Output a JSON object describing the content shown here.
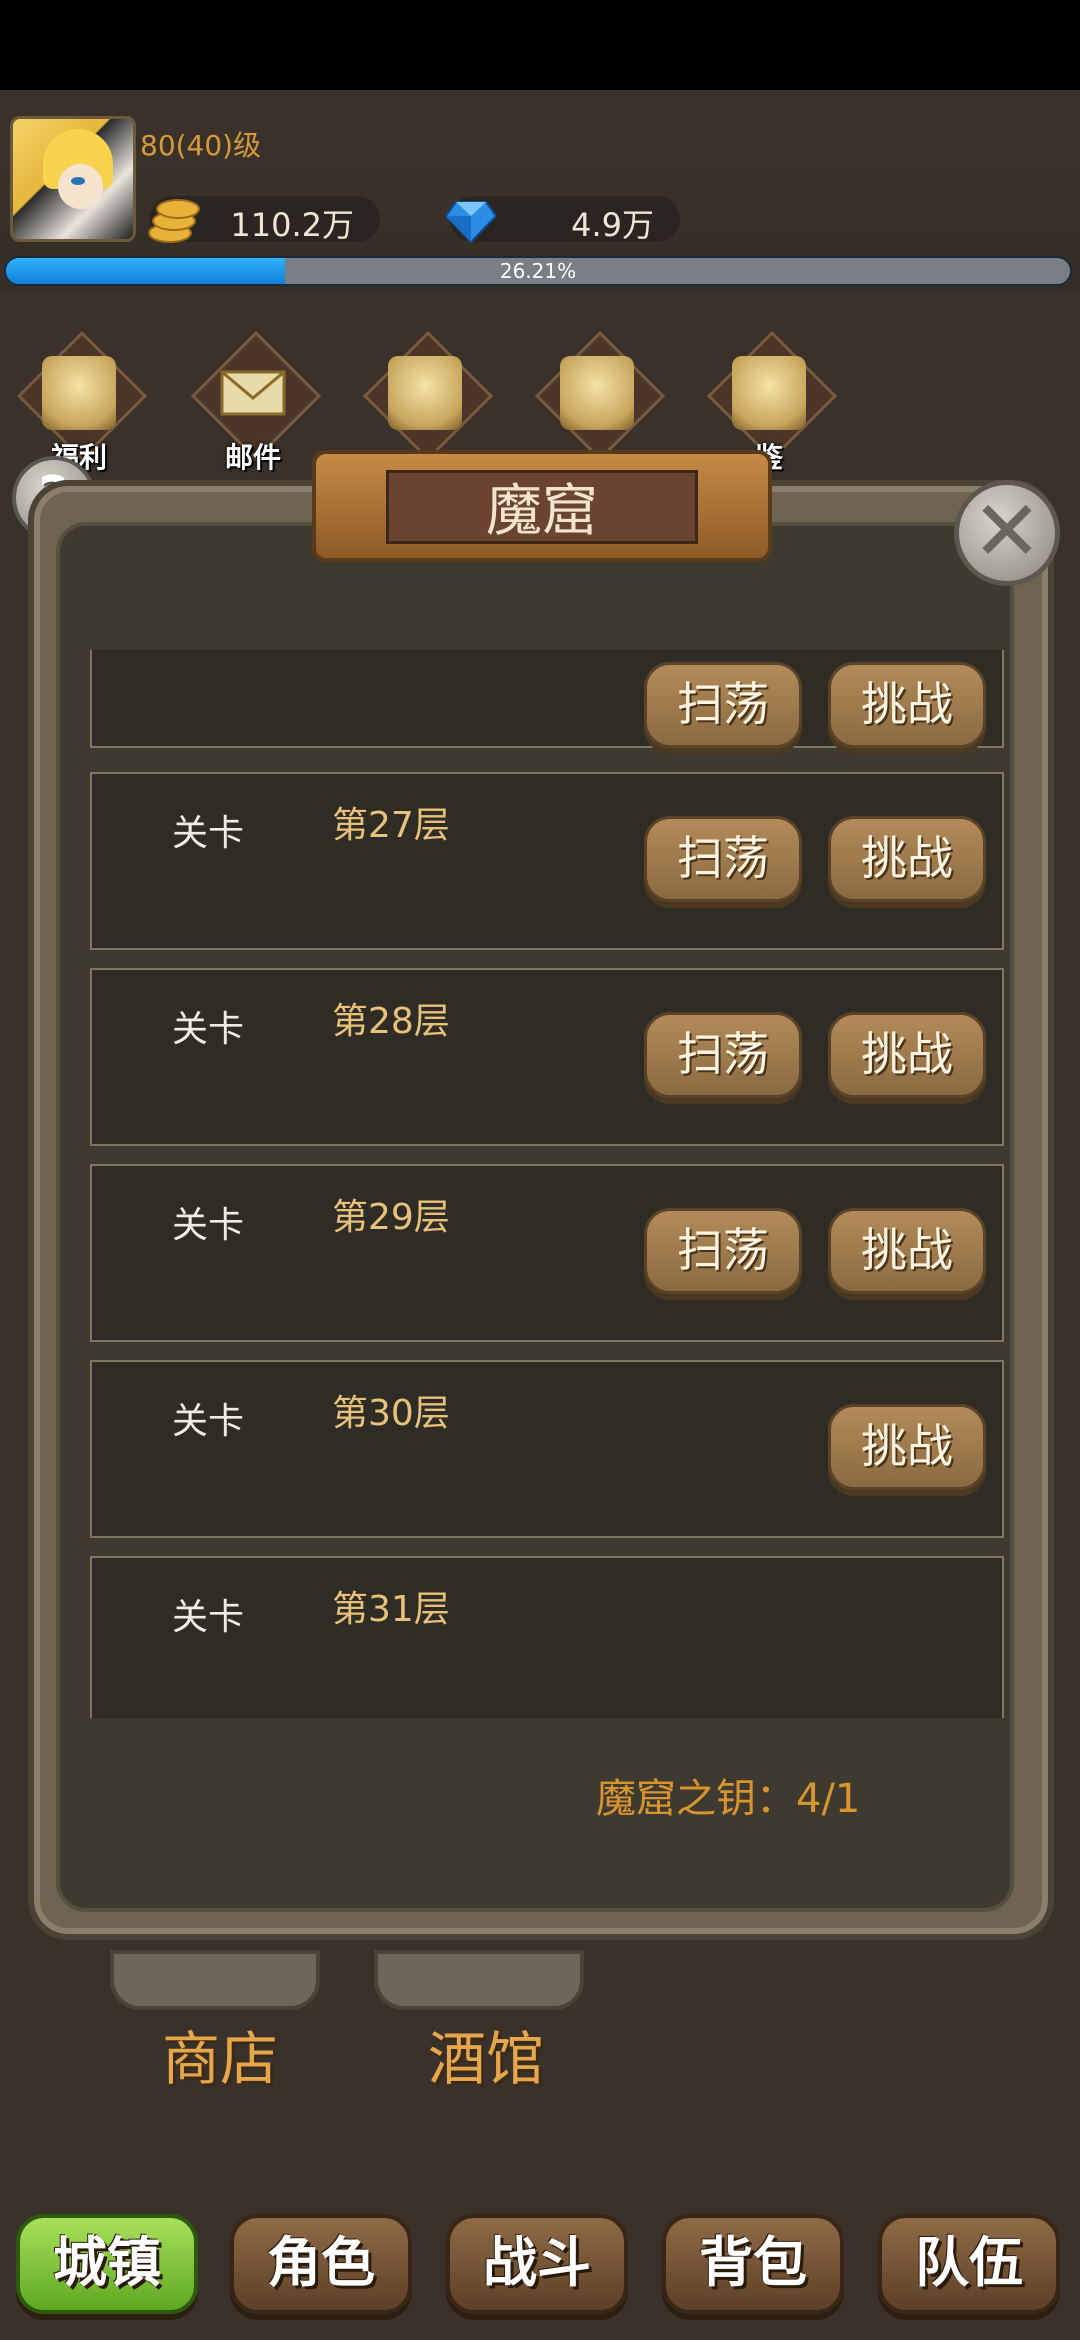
{
  "player": {
    "level": "80(40)级",
    "gold": "110.2万",
    "gems": "4.9万",
    "exp_percent": 26.21,
    "exp_label": "26.21%"
  },
  "top_icons": [
    {
      "name": "welfare",
      "label": "福利"
    },
    {
      "name": "mail",
      "label": "邮件"
    },
    {
      "name": "unknown1",
      "label": ""
    },
    {
      "name": "treasure",
      "label": ""
    },
    {
      "name": "codex",
      "label": "鉴"
    }
  ],
  "dialog": {
    "title": "魔窟",
    "rows": [
      {
        "stage_label": "",
        "floor": "",
        "sweep": "扫荡",
        "challenge": "挑战"
      },
      {
        "stage_label": "关卡",
        "floor": "第27层",
        "sweep": "扫荡",
        "challenge": "挑战"
      },
      {
        "stage_label": "关卡",
        "floor": "第28层",
        "sweep": "扫荡",
        "challenge": "挑战"
      },
      {
        "stage_label": "关卡",
        "floor": "第29层",
        "sweep": "扫荡",
        "challenge": "挑战"
      },
      {
        "stage_label": "关卡",
        "floor": "第30层",
        "sweep": "",
        "challenge": "挑战"
      },
      {
        "stage_label": "关卡",
        "floor": "第31层",
        "sweep": "",
        "challenge": ""
      }
    ],
    "key_label": "魔窟之钥：4/1"
  },
  "buildings": [
    {
      "label": "商店"
    },
    {
      "label": "酒馆"
    }
  ],
  "navbar": [
    {
      "label": "城镇",
      "active": true
    },
    {
      "label": "角色",
      "active": false
    },
    {
      "label": "战斗",
      "active": false
    },
    {
      "label": "背包",
      "active": false
    },
    {
      "label": "队伍",
      "active": false
    }
  ],
  "colors": {
    "accent_gold": "#d59a3a",
    "exp_blue": "#1d9cf0",
    "active_nav": "#8fd13e"
  }
}
